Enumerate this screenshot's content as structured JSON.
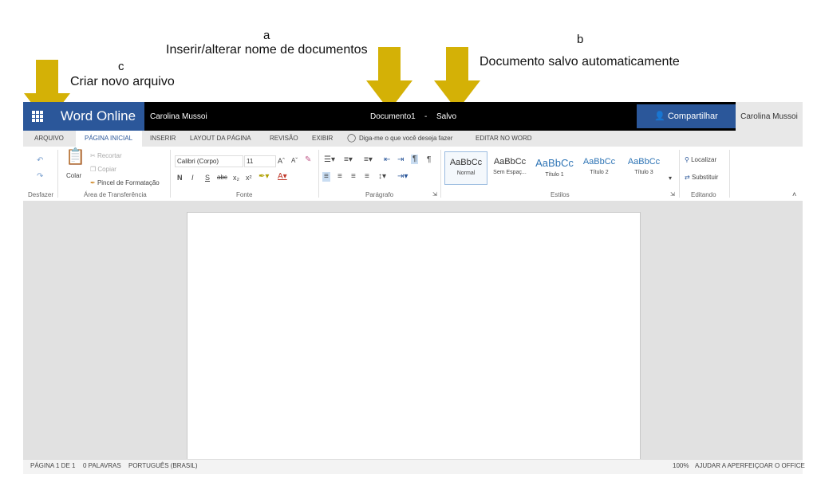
{
  "annotations": {
    "a": {
      "letter": "a",
      "text": "Inserir/alterar nome de documentos"
    },
    "b": {
      "letter": "b",
      "text": "Documento salvo automaticamente"
    },
    "c": {
      "letter": "c",
      "text": "Criar novo arquivo"
    },
    "arrow_color": "#d4b106"
  },
  "titlebar": {
    "app_name": "Word Online",
    "user": "Carolina Mussoi",
    "document_name": "Documento1",
    "separator": "-",
    "save_status": "Salvo",
    "share_label": "Compartilhar",
    "user_right": "Carolina Mussoi",
    "brand_color": "#2b579a"
  },
  "tabs": [
    "ARQUIVO",
    "PÁGINA INICIAL",
    "INSERIR",
    "LAYOUT DA PÁGINA",
    "REVISÃO",
    "EXIBIR",
    "Diga-me o que você deseja fazer",
    "EDITAR NO WORD"
  ],
  "ribbon": {
    "undo_group": "Desfazer",
    "paste_label": "Colar",
    "cut": "Recortar",
    "copy": "Copiar",
    "format_painter": "Pincel de Formatação",
    "clipboard_group": "Área de Transferência",
    "font_name": "Calibri (Corpo)",
    "font_size": "11",
    "font_group": "Fonte",
    "bold": "N",
    "italic": "I",
    "underline": "S",
    "strike": "abc",
    "subscript": "x₂",
    "superscript": "x²",
    "paragraph_group": "Parágrafo",
    "styles": [
      {
        "sample": "AaBbCc",
        "name": "Normal"
      },
      {
        "sample": "AaBbCc",
        "name": "Sem Espaç..."
      },
      {
        "sample": "AaBbCc",
        "name": "Título 1"
      },
      {
        "sample": "AaBbCc",
        "name": "Título 2"
      },
      {
        "sample": "AaBbCc",
        "name": "Título 3"
      }
    ],
    "styles_group": "Estilos",
    "find": "Localizar",
    "replace": "Substituir",
    "editing_group": "Editando"
  },
  "statusbar": {
    "page": "PÁGINA 1 DE 1",
    "words": "0 PALAVRAS",
    "language": "PORTUGUÊS (BRASIL)",
    "zoom": "100%",
    "help": "AJUDAR A APERFEIÇOAR O OFFICE"
  }
}
